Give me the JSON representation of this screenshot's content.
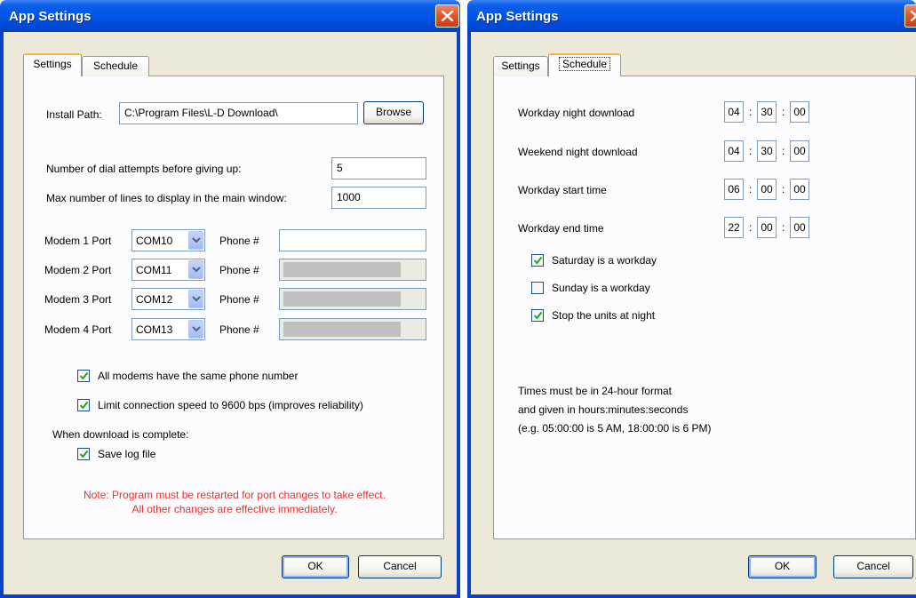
{
  "left_window": {
    "title": "App Settings",
    "tabs": [
      "Settings",
      "Schedule"
    ],
    "install_path_label": "Install Path:",
    "install_path_value": "C:\\Program Files\\L-D Download\\",
    "browse_label": "Browse",
    "dial_attempts_label": "Number of dial attempts before giving up:",
    "dial_attempts_value": "5",
    "max_lines_label": "Max number of lines to display in the main window:",
    "max_lines_value": "1000",
    "modems": [
      {
        "label": "Modem 1 Port",
        "port": "COM10",
        "phone_label": "Phone #",
        "phone_value": ""
      },
      {
        "label": "Modem 2 Port",
        "port": "COM11",
        "phone_label": "Phone #",
        "phone_value": ""
      },
      {
        "label": "Modem 3 Port",
        "port": "COM12",
        "phone_label": "Phone #",
        "phone_value": ""
      },
      {
        "label": "Modem 4 Port",
        "port": "COM13",
        "phone_label": "Phone #",
        "phone_value": ""
      }
    ],
    "same_phone_label": "All modems have the same phone number",
    "same_phone_checked": true,
    "limit_speed_label": "Limit connection speed to 9600 bps (improves reliability)",
    "limit_speed_checked": true,
    "when_complete_label": "When download is complete:",
    "save_log_label": "Save log file",
    "save_log_checked": true,
    "note_line1": "Note: Program must be restarted for port changes to take effect.",
    "note_line2": "All other changes are effective immediately.",
    "ok_label": "OK",
    "cancel_label": "Cancel"
  },
  "right_window": {
    "title": "App Settings",
    "tabs": [
      "Settings",
      "Schedule"
    ],
    "rows": [
      {
        "label": "Workday night download",
        "h": "04",
        "m": "30",
        "s": "00"
      },
      {
        "label": "Weekend night download",
        "h": "04",
        "m": "30",
        "s": "00"
      },
      {
        "label": "Workday start time",
        "h": "06",
        "m": "00",
        "s": "00"
      },
      {
        "label": "Workday end time",
        "h": "22",
        "m": "00",
        "s": "00"
      }
    ],
    "time_separator": ":",
    "saturday_label": "Saturday is a workday",
    "saturday_checked": true,
    "sunday_label": "Sunday is a workday",
    "sunday_checked": false,
    "stop_units_label": "Stop the units at night",
    "stop_units_checked": true,
    "info_line1": "Times must be in 24-hour format",
    "info_line2": "and given in hours:minutes:seconds",
    "info_line3": "(e.g. 05:00:00 is 5 AM, 18:00:00 is 6 PM)",
    "ok_label": "OK",
    "cancel_label": "Cancel"
  },
  "colors": {
    "titlebar": "#0055e5",
    "dialog_bg": "#ece9d8",
    "tab_panel_bg": "#fcfcfe",
    "note_text": "#e8322a",
    "close_button": "#e0572f"
  }
}
